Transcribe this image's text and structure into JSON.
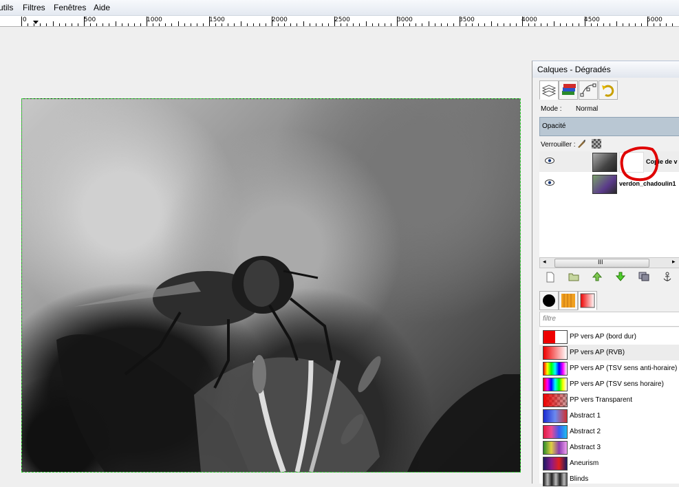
{
  "menubar": {
    "items": [
      {
        "label": "utils"
      },
      {
        "label": "Filtres"
      },
      {
        "label": "Fenêtres"
      },
      {
        "label": "Aide"
      }
    ]
  },
  "ruler": {
    "labels": [
      "0",
      "500",
      "1000",
      "1500",
      "2000",
      "2500",
      "3000",
      "3500",
      "4000",
      "4500",
      "5000"
    ]
  },
  "panel": {
    "title": "Calques - Dégradés",
    "mode_label": "Mode :",
    "mode_value": "Normal",
    "opacity_label": "Opacité",
    "lock_label": "Verrouiller :",
    "layers": [
      {
        "name": "Copie de v"
      },
      {
        "name": "verdon_chadoulin1"
      }
    ],
    "scrollbar_glyph": "III",
    "gradient_filter_placeholder": "filtre",
    "gradients": [
      {
        "name": "PP vers AP (bord dur)"
      },
      {
        "name": "PP vers AP (RVB)"
      },
      {
        "name": "PP vers AP (TSV sens anti-horaire)"
      },
      {
        "name": "PP vers AP (TSV sens horaire)"
      },
      {
        "name": "PP vers Transparent"
      },
      {
        "name": "Abstract 1"
      },
      {
        "name": "Abstract 2"
      },
      {
        "name": "Abstract 3"
      },
      {
        "name": "Aneurism"
      },
      {
        "name": "Blinds"
      }
    ]
  },
  "colors": {
    "selection_border": "#2fd12f",
    "annotation_red": "#e00000",
    "opacity_bar": "#b9c7d3"
  }
}
